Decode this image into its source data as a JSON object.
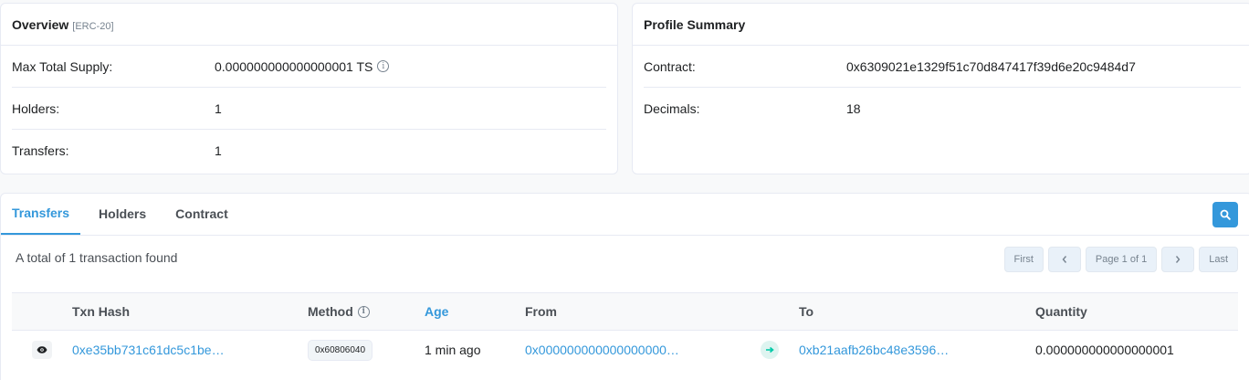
{
  "overview": {
    "title": "Overview",
    "subtitle": "[ERC-20]",
    "rows": [
      {
        "label": "Max Total Supply:",
        "value": "0.000000000000000001 TS"
      },
      {
        "label": "Holders:",
        "value": "1"
      },
      {
        "label": "Transfers:",
        "value": "1"
      }
    ]
  },
  "profile": {
    "title": "Profile Summary",
    "rows": [
      {
        "label": "Contract:",
        "value": "0x6309021e1329f51c70d847417f39d6e20c9484d7"
      },
      {
        "label": "Decimals:",
        "value": "18"
      }
    ]
  },
  "tabs": [
    {
      "label": "Transfers",
      "active": true
    },
    {
      "label": "Holders",
      "active": false
    },
    {
      "label": "Contract",
      "active": false
    }
  ],
  "summary": "A total of 1 transaction found",
  "pagination": {
    "first": "First",
    "page": "Page 1 of 1",
    "last": "Last"
  },
  "table": {
    "headers": {
      "txn_hash": "Txn Hash",
      "method": "Method",
      "age": "Age",
      "from": "From",
      "to": "To",
      "quantity": "Quantity"
    },
    "rows": [
      {
        "txn_hash": "0xe35bb731c61dc5c1be…",
        "method": "0x60806040",
        "age": "1 min ago",
        "from": "0x000000000000000000…",
        "to": "0xb21aafb26bc48e3596…",
        "quantity": "0.000000000000000001"
      }
    ]
  },
  "colors": {
    "accent": "#3498db",
    "arrow_green": "#00c9a7"
  },
  "icons": [
    "info-icon",
    "search-icon",
    "chevron-left-icon",
    "chevron-right-icon",
    "eye-icon",
    "arrow-right-icon"
  ]
}
